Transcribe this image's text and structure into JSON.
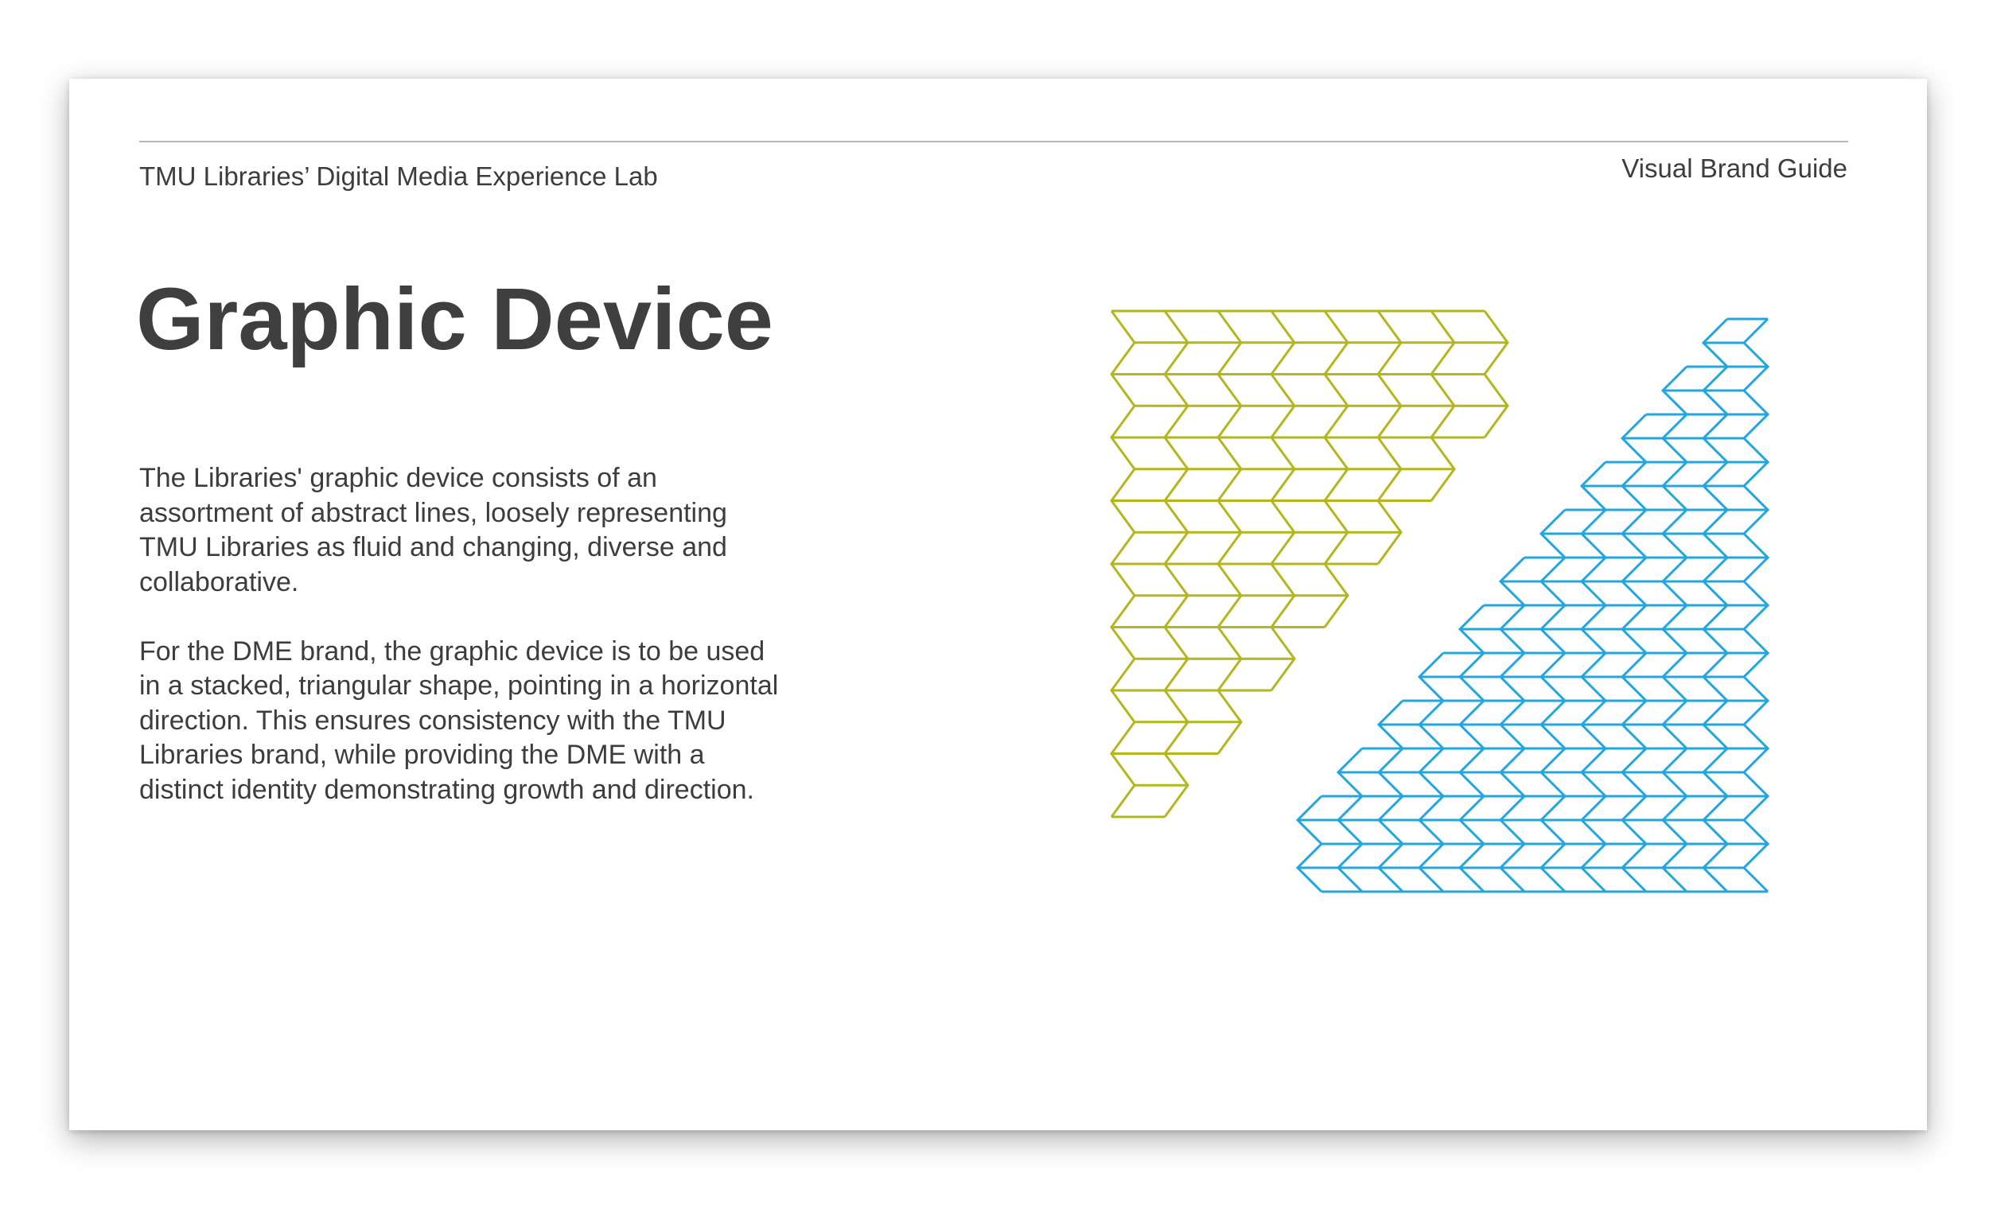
{
  "header": {
    "org_name": "TMU Libraries’ Digital Media Experience Lab",
    "guide_name": "Visual Brand Guide"
  },
  "title": "Graphic Device",
  "paragraphs": [
    "The Libraries' graphic device consists of an assortment of abstract lines, loosely representing TMU Libraries as fluid and changing, diverse and collaborative.",
    "For the DME brand, the graphic device is to be used in a stacked, triangular shape, pointing in a horizontal direction. This ensures consistency with the TMU Libraries brand, while providing the DME with a distinct identity demonstrating growth and direction."
  ],
  "graphic_device": {
    "left_pattern": {
      "color": "#b4b61e",
      "rows": 8,
      "columns": 7,
      "column_heights": [
        8,
        7,
        6,
        5,
        4,
        3,
        2
      ],
      "direction": "right"
    },
    "right_pattern": {
      "color": "#22a6df",
      "rows": 12,
      "columns": 11,
      "column_heights": [
        2,
        3,
        4,
        5,
        6,
        7,
        8,
        9,
        10,
        11,
        12
      ],
      "direction": "left"
    }
  }
}
